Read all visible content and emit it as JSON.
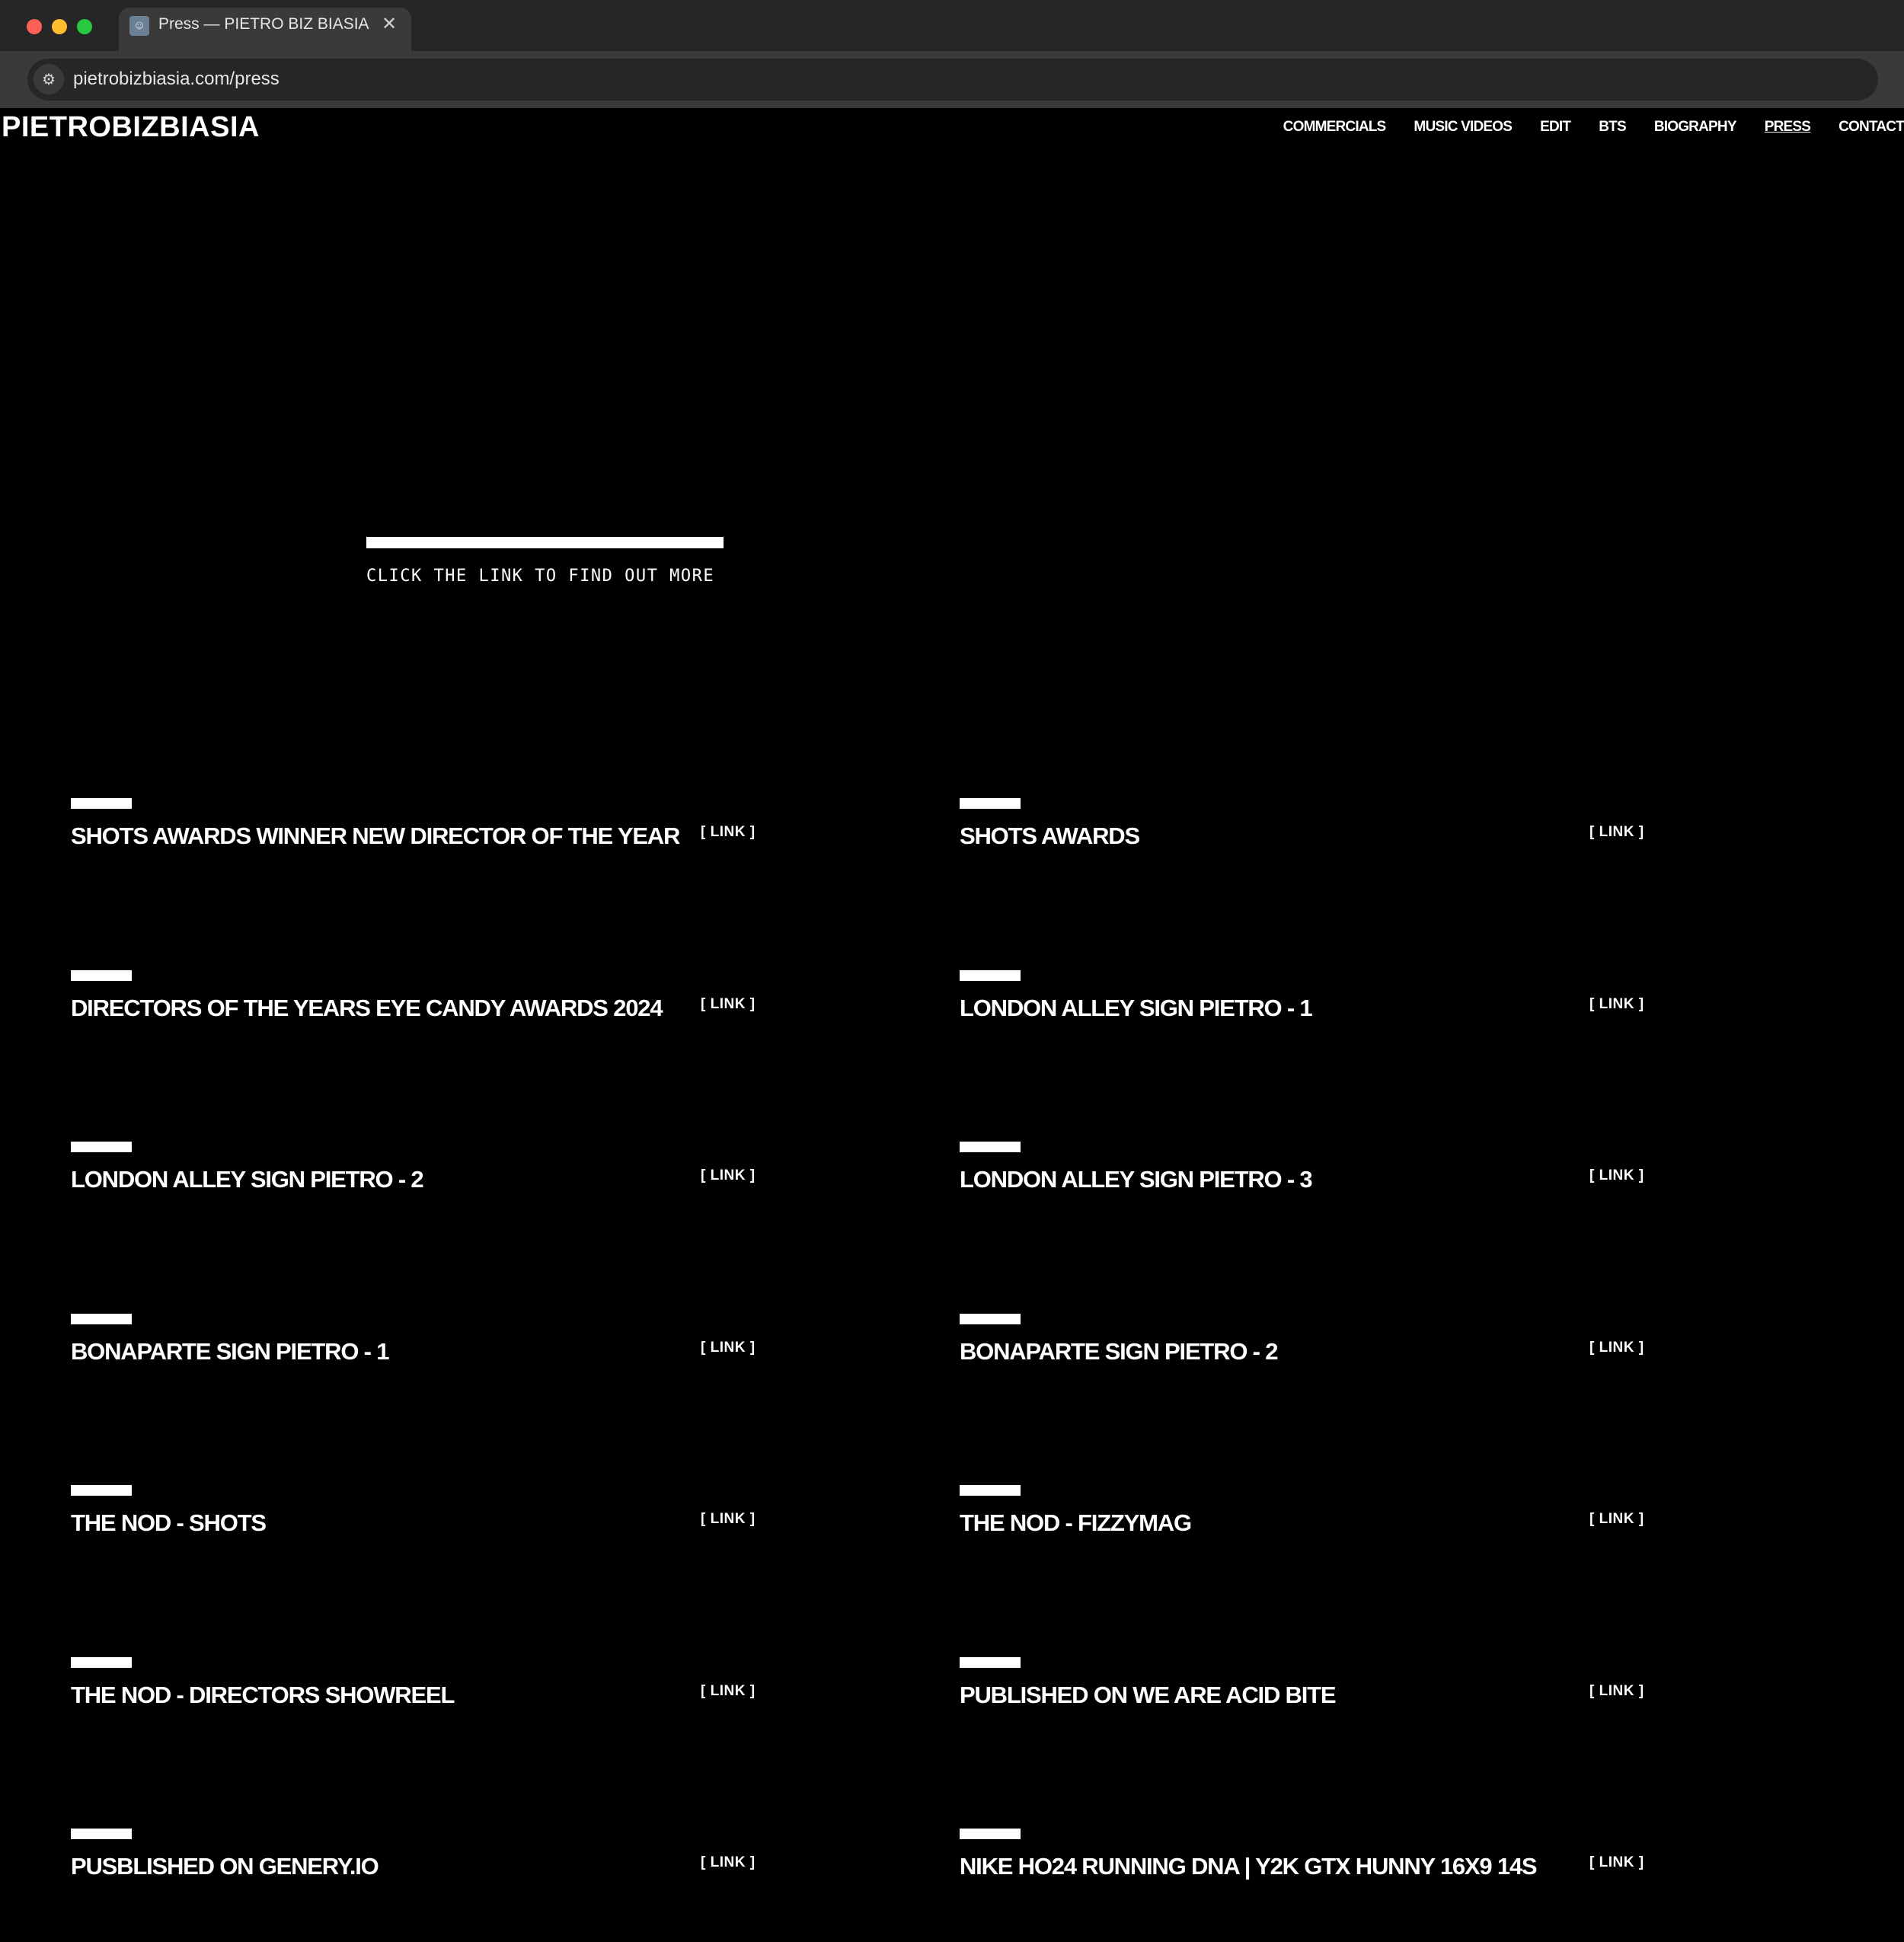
{
  "browser": {
    "tab_title": "Press — PIETRO BIZ BIASIA",
    "tab_close": "✕",
    "url": "pietrobizbiasia.com/press"
  },
  "site": {
    "logo": "PIETROBIZBIASIA",
    "nav": [
      "COMMERCIALS",
      "MUSIC VIDEOS",
      "EDIT",
      "BTS",
      "BIOGRAPHY",
      "PRESS",
      "CONTACT"
    ],
    "active_nav": "PRESS"
  },
  "intro": {
    "text": "CLICK THE LINK TO FIND OUT MORE"
  },
  "press": {
    "link_label": "[ LINK ]",
    "items": [
      "SHOTS AWARDS WINNER NEW DIRECTOR OF THE YEAR",
      "SHOTS AWARDS",
      "DIRECTORS OF THE YEARS EYE CANDY AWARDS 2024",
      "LONDON ALLEY SIGN PIETRO - 1",
      "LONDON ALLEY SIGN PIETRO - 2",
      "LONDON ALLEY SIGN PIETRO - 3",
      "BONAPARTE SIGN PIETRO - 1",
      "BONAPARTE SIGN PIETRO - 2",
      "THE NOD - SHOTS",
      "THE NOD - FIZZYMAG",
      "THE NOD - DIRECTORS SHOWREEL",
      "PUBLISHED ON WE ARE ACID BITE",
      "PUSBLISHED ON GENERY.IO",
      "NIKE HO24 RUNNING DNA | Y2K GTX HUNNY 16X9 14S"
    ]
  }
}
